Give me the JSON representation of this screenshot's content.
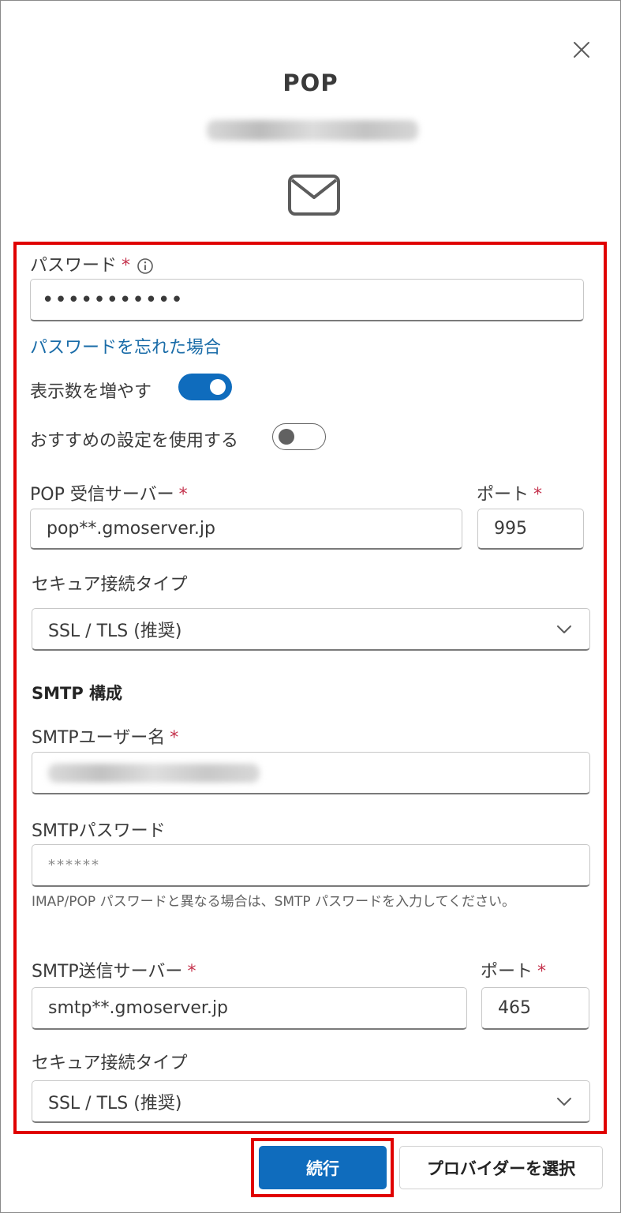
{
  "dialog": {
    "title": "POP",
    "close_icon": "close-icon",
    "mail_icon": "mail-icon"
  },
  "password": {
    "label": "パスワード",
    "required_mark": "*",
    "info_icon": "info-icon",
    "value": "•••••••••••",
    "forgot_link": "パスワードを忘れた場合"
  },
  "show_more": {
    "label": "表示数を増やす",
    "enabled": true
  },
  "recommended": {
    "label": "おすすめの設定を使用する",
    "enabled": false
  },
  "pop": {
    "server_label": "POP 受信サーバー",
    "server_value": "pop**.gmoserver.jp",
    "port_label": "ポート",
    "port_value": "995",
    "secure_label": "セキュア接続タイプ",
    "secure_value": "SSL / TLS (推奨)"
  },
  "smtp": {
    "section_title": "SMTP 構成",
    "username_label": "SMTPユーザー名",
    "password_label": "SMTPパスワード",
    "password_placeholder": "******",
    "help_text": "IMAP/POP パスワードと異なる場合は、SMTP パスワードを入力してください。",
    "server_label": "SMTP送信サーバー",
    "server_value": "smtp**.gmoserver.jp",
    "port_label": "ポート",
    "port_value": "465",
    "secure_label": "セキュア接続タイプ",
    "secure_value": "SSL / TLS (推奨)"
  },
  "footer": {
    "continue_label": "続行",
    "choose_provider_label": "プロバイダーを選択"
  },
  "colors": {
    "accent": "#0f6cbd",
    "highlight": "#e00000",
    "required": "#c4314b",
    "link": "#1a6ca8"
  }
}
